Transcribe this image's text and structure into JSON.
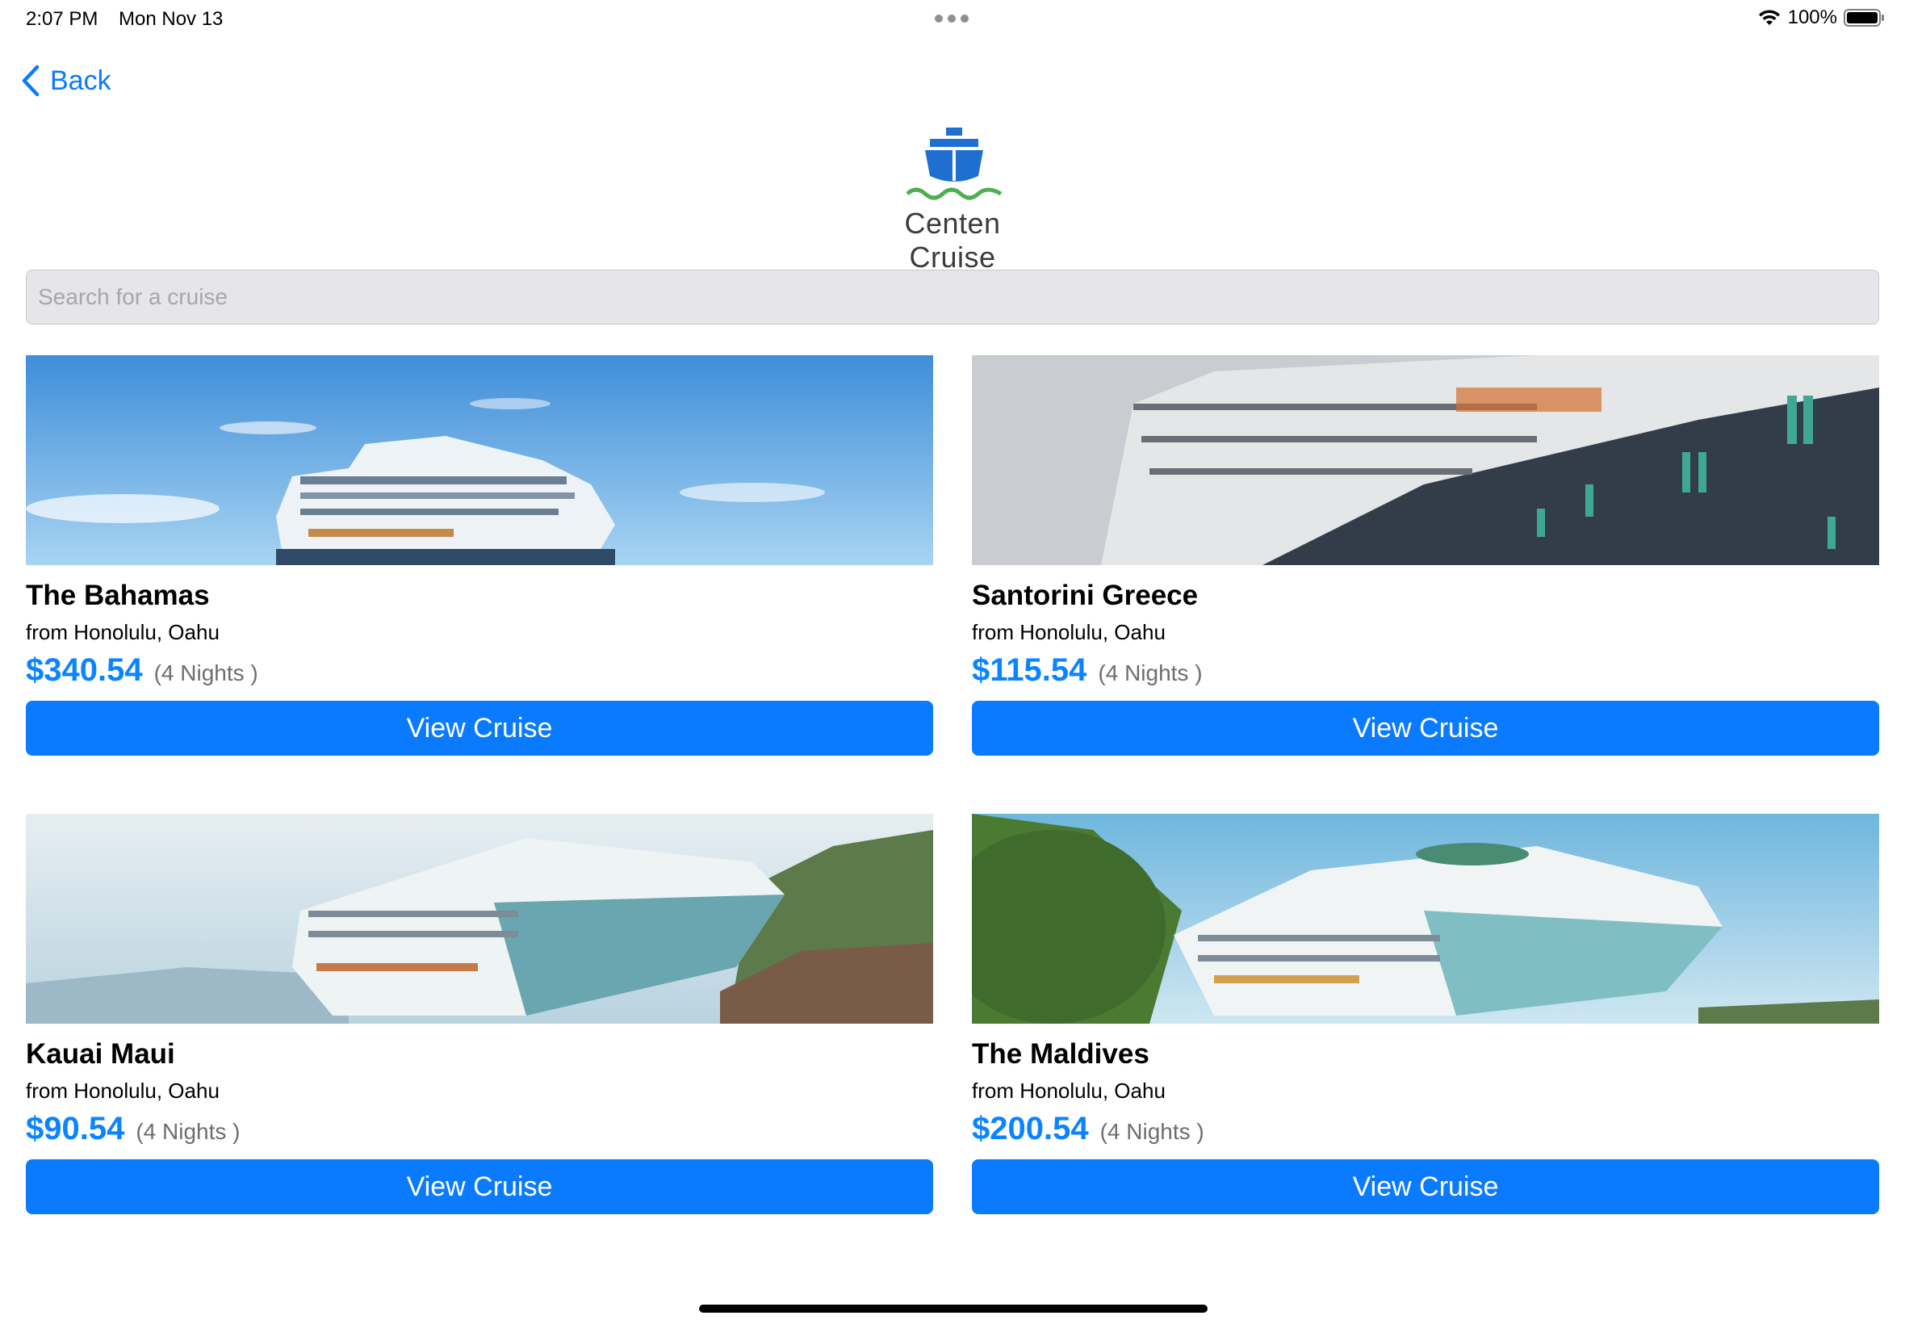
{
  "status_bar": {
    "time": "2:07 PM",
    "date": "Mon Nov 13",
    "battery": "100%"
  },
  "nav": {
    "back_label": "Back"
  },
  "brand": {
    "name": "Centen Cruise"
  },
  "search": {
    "placeholder": "Search for a cruise",
    "value": ""
  },
  "cruises": [
    {
      "title": "The Bahamas",
      "origin": "from Honolulu, Oahu",
      "price": "$340.54",
      "nights": "(4 Nights )",
      "button_label": "View Cruise"
    },
    {
      "title": "Santorini Greece",
      "origin": "from Honolulu, Oahu",
      "price": "$115.54",
      "nights": "(4 Nights )",
      "button_label": "View Cruise"
    },
    {
      "title": "Kauai Maui",
      "origin": "from Honolulu, Oahu",
      "price": "$90.54",
      "nights": "(4 Nights )",
      "button_label": "View Cruise"
    },
    {
      "title": "The Maldives",
      "origin": "from Honolulu, Oahu",
      "price": "$200.54",
      "nights": "(4 Nights )",
      "button_label": "View Cruise"
    }
  ],
  "colors": {
    "accent": "#0a7aff",
    "price": "#0a84ff",
    "search_bg": "#e5e5ea",
    "logo_blue": "#1f6fd1",
    "logo_wave": "#4caf50"
  },
  "icons": {
    "back": "chevron-left-icon",
    "logo": "ship-icon",
    "wifi": "wifi-icon",
    "battery": "battery-icon"
  }
}
